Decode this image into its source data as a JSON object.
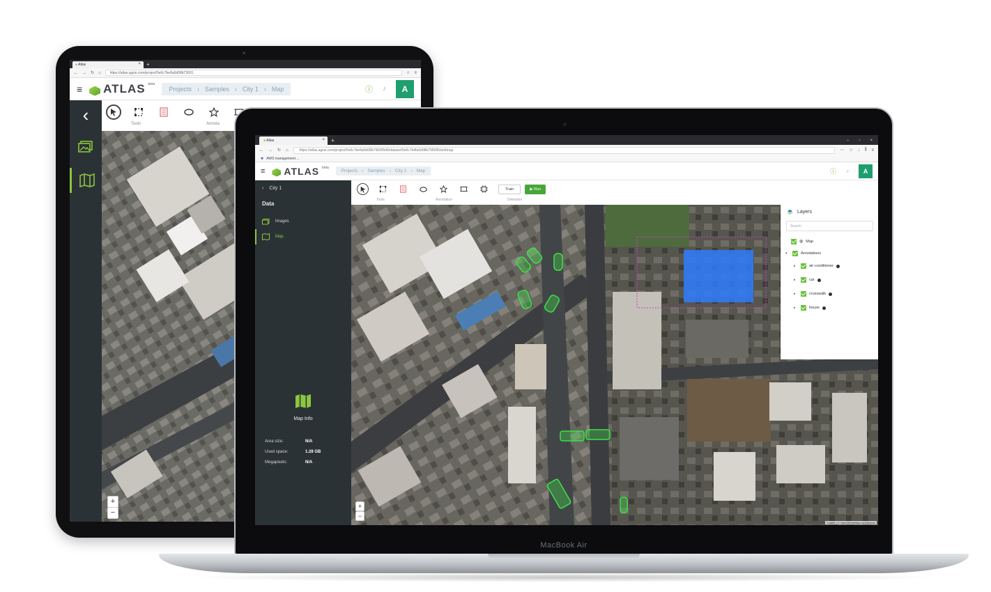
{
  "tablet": {
    "browser": {
      "tab_title": "Atlas",
      "url": "https://atlas.ugsis.com/project/5e6c7be8a0d08b73601"
    },
    "app": {
      "logo_text": "ATLAS",
      "logo_beta": "beta",
      "breadcrumbs": [
        "Projects",
        "Samples",
        "City 1",
        "Map"
      ],
      "avatar_letter": "A"
    },
    "tools_label": "Tools",
    "annotation_label": "Annota"
  },
  "laptop": {
    "brand": "MacBook Air",
    "browser": {
      "tab_title": "Atlas",
      "url": "https://atlas.ugsis.com/project/5e6c7be8a0d08b796095d6/dataset/5e6c7b4fa0d08b796095de4/map",
      "bookmark": "AWS management ..."
    },
    "app": {
      "logo_text": "ATLAS",
      "logo_beta": "beta",
      "breadcrumbs": [
        "Projects",
        "Samples",
        "City 1",
        "Map"
      ],
      "avatar_letter": "A"
    },
    "sidebar": {
      "back_label": "City 1",
      "section_title": "Data",
      "items": [
        {
          "label": "Images",
          "active": false
        },
        {
          "label": "Map",
          "active": true
        }
      ],
      "info_title": "Map Info",
      "stats": [
        {
          "key": "Area size:",
          "value": "N/A"
        },
        {
          "key": "Used space:",
          "value": "1.28 GB"
        },
        {
          "key": "Megapixels:",
          "value": "N/A"
        }
      ]
    },
    "toolbar": {
      "tools_label": "Tools",
      "annotation_label": "Annotation",
      "detection_label": "Detection",
      "train_label": "Train",
      "run_label": "Run"
    },
    "layers": {
      "title": "Layers",
      "search_placeholder": "Search",
      "map_label": "Map",
      "annotations_label": "Annotations",
      "items": [
        "air-conditioner",
        "car",
        "crosswalk",
        "house"
      ]
    },
    "attribution": "Leaflet | © OpenStreetMap contributors"
  },
  "colors": {
    "accent_green": "#8cc63f",
    "sidebar_dark": "#2b3236",
    "annotation_green": "#3fe04a",
    "selection_blue": "#2f7bff",
    "selection_magenta": "#d23cd2"
  }
}
